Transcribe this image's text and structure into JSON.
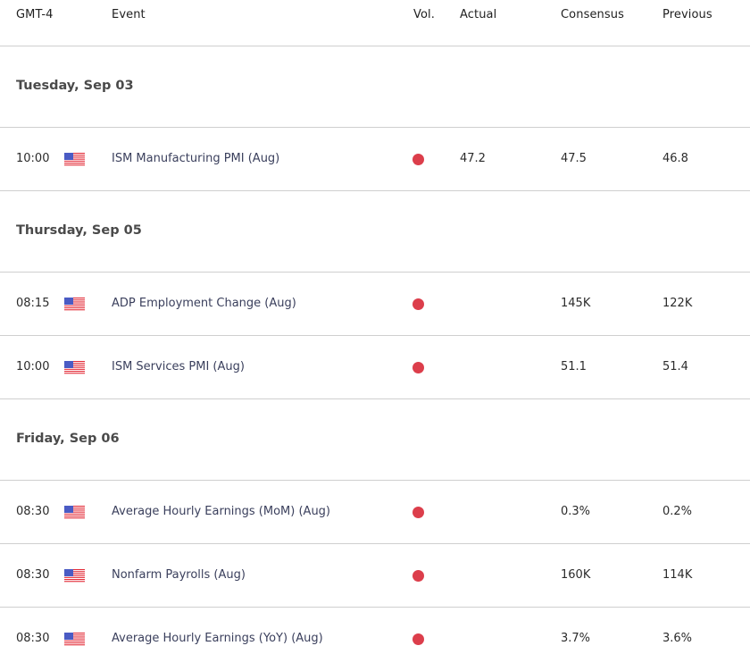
{
  "timezone_label": "GMT-4",
  "columns": {
    "time": "GMT-4",
    "event": "Event",
    "volatility": "Vol.",
    "actual": "Actual",
    "consensus": "Consensus",
    "previous": "Previous"
  },
  "colors": {
    "high_volatility": "#dc3e4b",
    "divider": "#cfcfcf",
    "event_text": "#3a3f5c"
  },
  "days": [
    {
      "date": "Tuesday, Sep 03",
      "events": [
        {
          "time": "10:00",
          "country_icon": "us-flag-icon",
          "name": "ISM Manufacturing PMI (Aug)",
          "volatility": "high",
          "actual": "47.2",
          "consensus": "47.5",
          "previous": "46.8"
        }
      ]
    },
    {
      "date": "Thursday, Sep 05",
      "events": [
        {
          "time": "08:15",
          "country_icon": "us-flag-icon",
          "name": "ADP Employment Change (Aug)",
          "volatility": "high",
          "actual": "",
          "consensus": "145K",
          "previous": "122K"
        },
        {
          "time": "10:00",
          "country_icon": "us-flag-icon",
          "name": "ISM Services PMI (Aug)",
          "volatility": "high",
          "actual": "",
          "consensus": "51.1",
          "previous": "51.4"
        }
      ]
    },
    {
      "date": "Friday, Sep 06",
      "events": [
        {
          "time": "08:30",
          "country_icon": "us-flag-icon",
          "name": "Average Hourly Earnings (MoM) (Aug)",
          "volatility": "high",
          "actual": "",
          "consensus": "0.3%",
          "previous": "0.2%"
        },
        {
          "time": "08:30",
          "country_icon": "us-flag-icon",
          "name": "Nonfarm Payrolls (Aug)",
          "volatility": "high",
          "actual": "",
          "consensus": "160K",
          "previous": "114K"
        },
        {
          "time": "08:30",
          "country_icon": "us-flag-icon",
          "name": "Average Hourly Earnings (YoY) (Aug)",
          "volatility": "high",
          "actual": "",
          "consensus": "3.7%",
          "previous": "3.6%"
        }
      ]
    }
  ]
}
